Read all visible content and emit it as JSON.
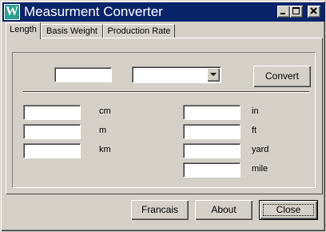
{
  "window": {
    "title": "Measurment Converter",
    "icon": "W"
  },
  "title_buttons": [
    "minimize-icon",
    "maximize-icon",
    "close-icon"
  ],
  "tabs": [
    {
      "label": "Length",
      "active": true
    },
    {
      "label": "Basis Weight",
      "active": false
    },
    {
      "label": "Production Rate",
      "active": false
    }
  ],
  "converter": {
    "input_value": "",
    "unit_selected": "",
    "convert_label": "Convert"
  },
  "metric": [
    {
      "unit": "cm",
      "value": ""
    },
    {
      "unit": "m",
      "value": ""
    },
    {
      "unit": "km",
      "value": ""
    }
  ],
  "imperial": [
    {
      "unit": "in",
      "value": ""
    },
    {
      "unit": "ft",
      "value": ""
    },
    {
      "unit": "yard",
      "value": ""
    },
    {
      "unit": "mile",
      "value": ""
    }
  ],
  "footer": {
    "francais_label": "Francais",
    "about_label": "About",
    "close_label": "Close"
  }
}
